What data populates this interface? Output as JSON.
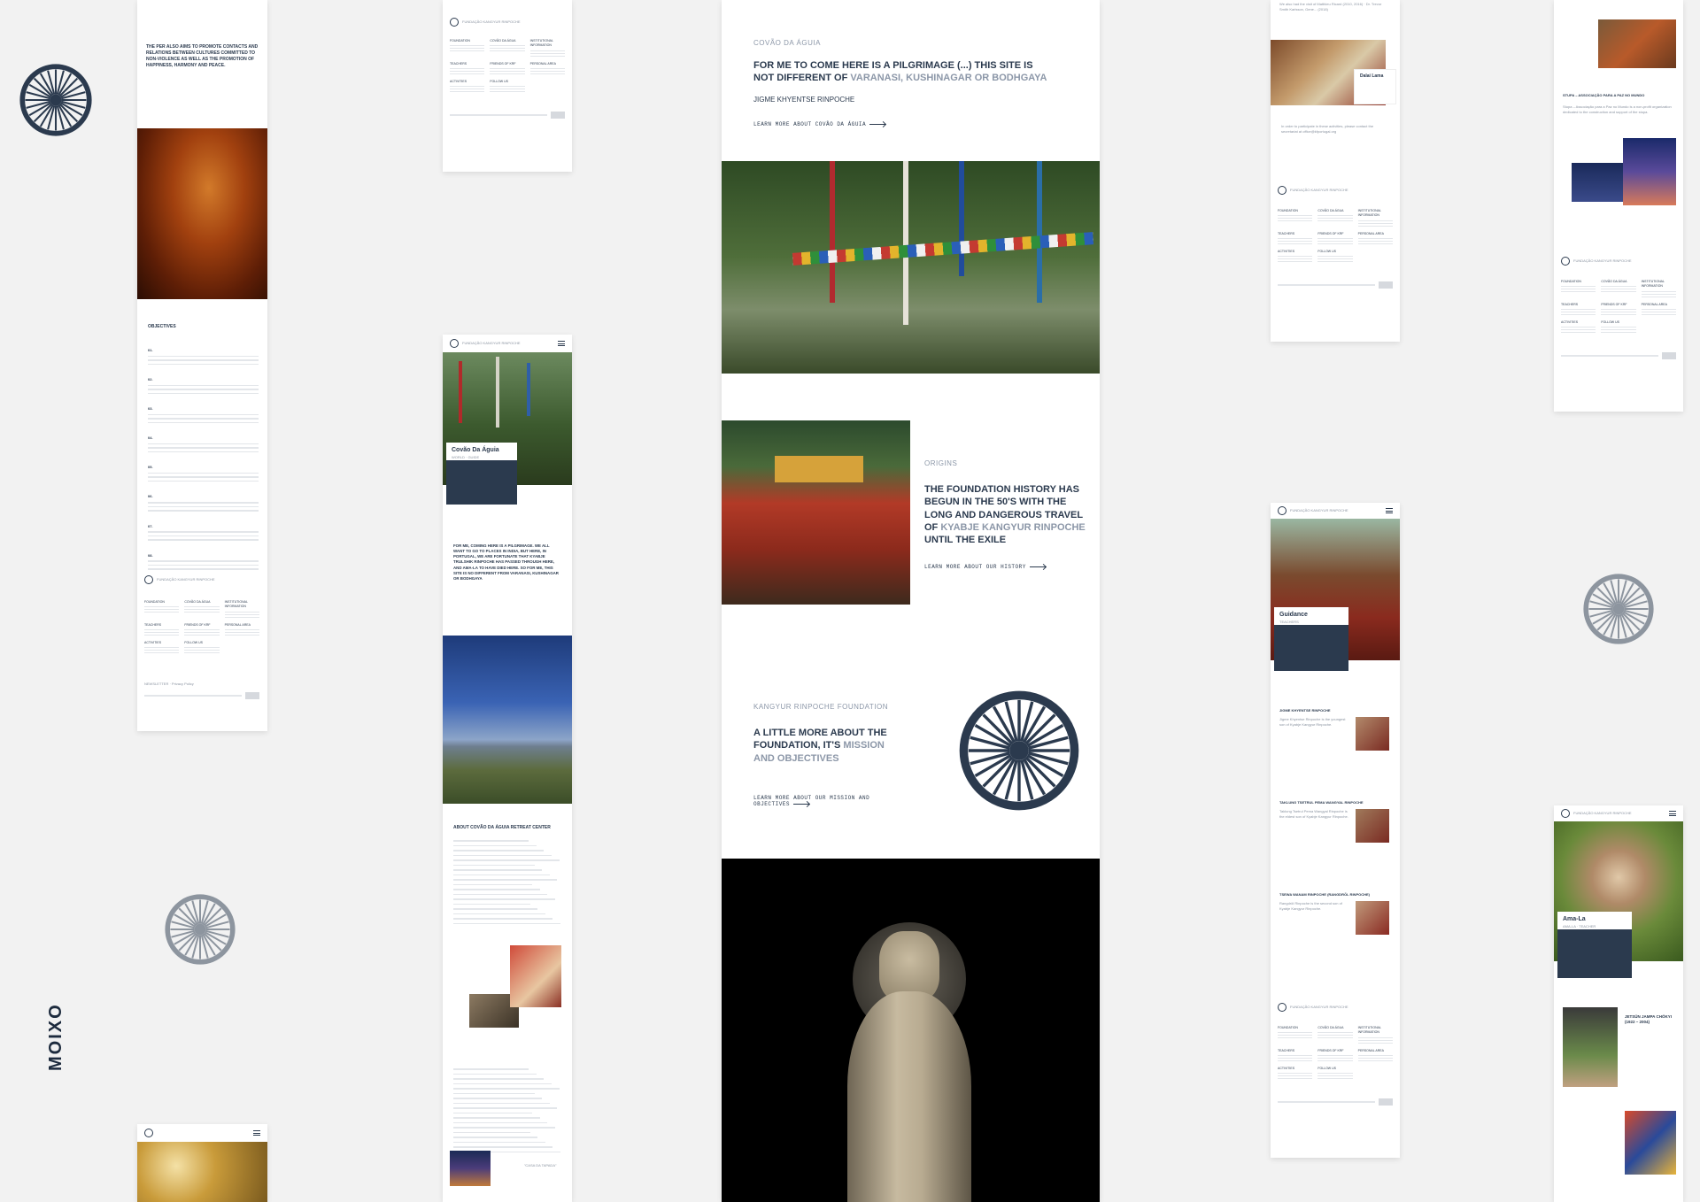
{
  "brand": "MOIXO",
  "colors": {
    "navy": "#2b3a4e",
    "accent": "#8c97a8",
    "bg": "#f2f2f2"
  },
  "col1": {
    "intro": "THE PER ALSO AIMS TO PROMOTE CONTACTS AND RELATIONS BETWEEN CULTURES COMMITTED TO NON-VIOLENCE AS WELL AS THE PROMOTION OF HAPPINESS, HARMONY AND PEACE.",
    "objectives_title": "OBJECTIVES",
    "objectives": [
      "01.",
      "02.",
      "03.",
      "04.",
      "05.",
      "06.",
      "07.",
      "08."
    ],
    "footer": {
      "org": "FUNDAÇÃO KANGYUR RINPOCHE",
      "cols": [
        "FOUNDATION",
        "COVÃO DA ÁGUA",
        "INSTITUTIONAL INFORMATION",
        "TEACHERS",
        "FRIENDS OF KRF",
        "PERSONAL AREA",
        "ACTIVITIES",
        "FOLLOW US"
      ],
      "newsletter": "NEWSLETTER",
      "privacy": "Privacy Policy"
    }
  },
  "col2": {
    "hero_title": "Covão Da Águia",
    "hero_sub": "WORLD · GUIDE",
    "quote": "FOR ME, COMING HERE IS A PILGRIMAGE. WE ALL WANT TO GO TO PLACES IN INDIA, BUT HERE, IN PORTUGAL, WE ARE FORTUNATE THAT KYABJE TRULSHIK RINPOCHE HAS PASSED THROUGH HERE, AND AMA-LA TO HAVE DIED HERE. SO FOR ME, THIS SITE IS NO DIFFERENT FROM VARANASI, KUSHINAGAR OR BODHGAYA",
    "about_title": "ABOUT COVÃO DA ÁGUIA RETREAT CENTER",
    "photo_caption": "\"CASA DA TAPADA\""
  },
  "col3": {
    "kicker1": "COVÃO DA ÁGUIA",
    "quote_a": "FOR ME TO COME HERE IS A PILGRIMAGE (...) THIS SITE IS NOT DIFFERENT OF ",
    "quote_b": "VARANASI, KUSHINAGAR OR BODHGAYA",
    "quote_author": "JIGME KHYENTSE RINPOCHE",
    "learn1": "LEARN MORE ABOUT COVÃO DA ÁGUIA",
    "kicker2": "ORIGINS",
    "history_a": "THE FOUNDATION HISTORY HAS BEGUN IN THE 50'S WITH THE LONG AND DANGEROUS TRAVEL OF ",
    "history_b": "KYABJE KANGYUR RINPOCHE",
    "history_c": " UNTIL THE EXILE",
    "learn2": "LEARN MORE ABOUT OUR HISTORY",
    "kicker3": "KANGYUR RINPOCHE FOUNDATION",
    "mission_a": "A LITTLE MORE ABOUT THE FOUNDATION, IT'S ",
    "mission_b": "MISSION AND OBJECTIVES",
    "learn3": "LEARN MORE ABOUT OUR MISSION AND OBJECTIVES"
  },
  "col4": {
    "card_name": "Dalai Lama",
    "contact": "In order to participate in these activities, please contact the secretariat at office@kfportugal.org",
    "guidance_title": "Guidance",
    "guidance_sub": "TEACHERS",
    "t1": "JIGME KHYENTSE RINPOCHE",
    "t2": "TAKLUNG TSETRUL PEMA WANGYAL RINPOCHE",
    "t3": "TSEWA WANAM RINPOCHE (RANGDRÖL RINPOCHE)"
  },
  "col5": {
    "stupa": "STUPA – ASSOCIAÇÃO PARA A PAZ NO MUNDO",
    "ama_title": "Ama-La",
    "ama_sub": "AMA-LA · TEACHER",
    "jetsun": "JETSÜN JAMPA CHÖKYI (1922 – 2004)"
  }
}
